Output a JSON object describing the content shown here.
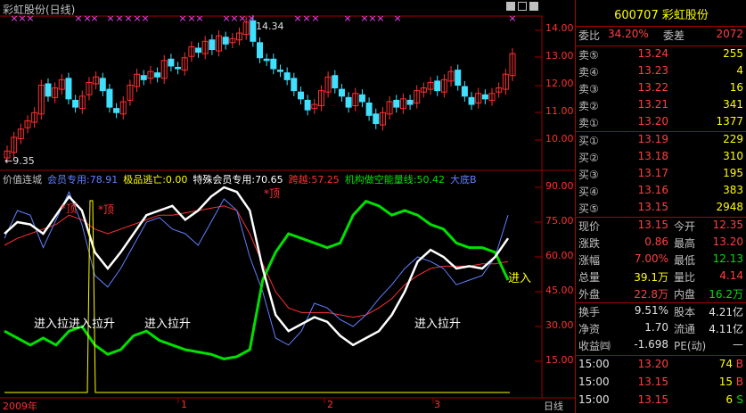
{
  "title": "彩虹股份(日线)",
  "stock": {
    "code": "600707",
    "name": "彩虹股份"
  },
  "colors": {
    "up": "#ff3030",
    "down": "#40e0ff",
    "frame": "#a00000",
    "green": "#00e000",
    "yellow": "#ffff00",
    "white": "#ffffff",
    "magenta": "#ff40ff",
    "blue": "#6080ff"
  },
  "price_chart": {
    "high_label": "14.34",
    "low_label": "9.35",
    "y_ticks": [
      "14.00",
      "13.00",
      "12.00",
      "11.00",
      "10.00"
    ],
    "marker_glyph": "×"
  },
  "indicator": {
    "legend": [
      {
        "text": "价值连城",
        "color": "#c0c0c0"
      },
      {
        "text": "会员专用:78.91",
        "color": "#6080ff"
      },
      {
        "text": "极品逃亡:0.00",
        "color": "#ffff00"
      },
      {
        "text": "特殊会员专用:70.65",
        "color": "#ffffff"
      },
      {
        "text": "跨越:57.25",
        "color": "#ff3030"
      },
      {
        "text": "机构做空能量线:50.42",
        "color": "#00e000"
      },
      {
        "text": "大底B",
        "color": "#6080ff"
      }
    ],
    "y_ticks": [
      "90.00",
      "75.00",
      "60.00",
      "45.00",
      "30.00",
      "15.00"
    ],
    "top_labels": [
      "*顶",
      "*顶",
      "*顶"
    ],
    "signal_labels": [
      "进入拉进入拉升",
      "进入拉升",
      "进入拉升",
      "进入"
    ]
  },
  "dates": [
    "2009年",
    "1",
    "2",
    "3"
  ],
  "period_label": "日线",
  "quote": {
    "weibi_label": "委比",
    "weibi": "34.20%",
    "weicha_label": "委差",
    "weicha": "2072",
    "asks": [
      {
        "label": "卖⑤",
        "price": "13.24",
        "vol": "255"
      },
      {
        "label": "卖④",
        "price": "13.23",
        "vol": "4"
      },
      {
        "label": "卖③",
        "price": "13.22",
        "vol": "16"
      },
      {
        "label": "卖②",
        "price": "13.21",
        "vol": "341"
      },
      {
        "label": "卖①",
        "price": "13.20",
        "vol": "1377"
      }
    ],
    "bids": [
      {
        "label": "买①",
        "price": "13.19",
        "vol": "229"
      },
      {
        "label": "买②",
        "price": "13.18",
        "vol": "310"
      },
      {
        "label": "买③",
        "price": "13.17",
        "vol": "195"
      },
      {
        "label": "买④",
        "price": "13.16",
        "vol": "383"
      },
      {
        "label": "买⑤",
        "price": "13.15",
        "vol": "2948"
      }
    ],
    "stats": [
      {
        "l1": "现价",
        "v1": "13.15",
        "c1": "red",
        "l2": "今开",
        "v2": "12.35",
        "c2": "red"
      },
      {
        "l1": "涨跌",
        "v1": "0.86",
        "c1": "red",
        "l2": "最高",
        "v2": "13.20",
        "c2": "red"
      },
      {
        "l1": "涨幅",
        "v1": "7.00%",
        "c1": "red",
        "l2": "最低",
        "v2": "12.13",
        "c2": "green"
      },
      {
        "l1": "总量",
        "v1": "39.1万",
        "c1": "yellow",
        "l2": "量比",
        "v2": "4.14",
        "c2": "red"
      },
      {
        "l1": "外盘",
        "v1": "22.8万",
        "c1": "red",
        "l2": "内盘",
        "v2": "16.2万",
        "c2": "green"
      }
    ],
    "stats2": [
      {
        "l1": "换手",
        "v1": "9.51%",
        "c1": "white",
        "l2": "股本",
        "v2": "4.21亿",
        "c2": "white"
      },
      {
        "l1": "净资",
        "v1": "1.70",
        "c1": "white",
        "l2": "流通",
        "v2": "4.11亿",
        "c2": "white"
      },
      {
        "l1": "收益㈣",
        "v1": "-1.698",
        "c1": "white",
        "l2": "PE(动)",
        "v2": "—",
        "c2": "white"
      }
    ],
    "ticks": [
      {
        "time": "15:00",
        "price": "13.20",
        "vol": "74",
        "side": "B"
      },
      {
        "time": "15:00",
        "price": "13.15",
        "vol": "15",
        "side": "B"
      },
      {
        "time": "15:00",
        "price": "13.15",
        "vol": "6",
        "side": "S"
      }
    ]
  }
}
